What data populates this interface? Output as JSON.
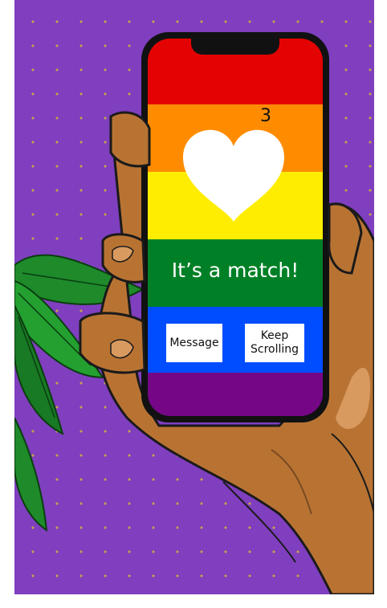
{
  "app": {
    "match_count": "3",
    "match_message": "It’s a match!",
    "buttons": {
      "message_label": "Message",
      "keep_scrolling_label": "Keep Scrolling"
    }
  },
  "colors": {
    "background_purple": "#7f3fbf",
    "dot_gold": "#c9a24a",
    "rainbow": [
      "#e40303",
      "#ff8c00",
      "#ffed00",
      "#008026",
      "#004dff",
      "#750787"
    ],
    "skin": "#b87333",
    "leaf_green": "#1e8a2a"
  },
  "icons": {
    "heart": "heart-icon"
  }
}
